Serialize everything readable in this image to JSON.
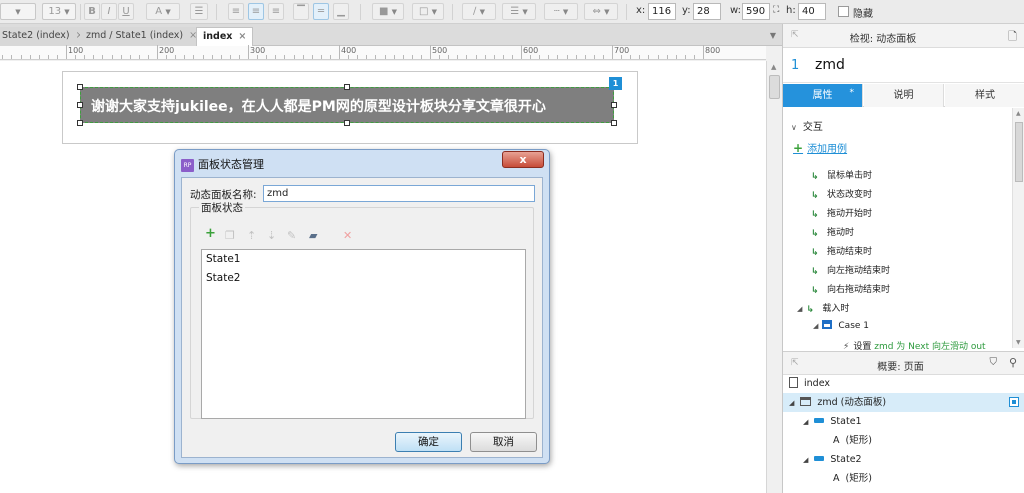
{
  "toolbar": {
    "font_size": "13",
    "x_label": "x:",
    "x_value": "116",
    "y_label": "y:",
    "y_value": "28",
    "w_label": "w:",
    "w_value": "590",
    "h_label": "h:",
    "h_value": "40",
    "hide_label": "隐藏",
    "bold": "B",
    "italic": "I",
    "underline": "U",
    "font_color": "A"
  },
  "tabs": [
    {
      "label": "State2 (index)",
      "close": "×"
    },
    {
      "label": "zmd / State1 (index)",
      "close": "×"
    },
    {
      "label": "index",
      "close": "×"
    }
  ],
  "ruler": {
    "labels": [
      "100",
      "200",
      "300",
      "400",
      "500",
      "600",
      "700",
      "800"
    ]
  },
  "canvas": {
    "panel_text": "谢谢大家支持jukilee，在人人都是PM网的原型设计板块分享文章很开心",
    "badge": "1"
  },
  "dialog": {
    "title": "面板状态管理",
    "icon_text": "RP",
    "close": "x",
    "name_label": "动态面板名称:",
    "name_value": "zmd",
    "group_title": "面板状态",
    "states": [
      "State1",
      "State2"
    ],
    "ok": "确定",
    "cancel": "取消"
  },
  "inspector": {
    "title": "检视: 动态面板",
    "object_number": "1",
    "object_name": "zmd",
    "tabs": [
      "属性",
      "说明",
      "样式"
    ],
    "tab_star": "*",
    "interaction": "交互",
    "add_case": "添加用例",
    "events": [
      "鼠标单击时",
      "状态改变时",
      "拖动开始时",
      "拖动时",
      "拖动结束时",
      "向左拖动结束时",
      "向右拖动结束时"
    ],
    "onload": "载入时",
    "case_name": "Case 1",
    "action_prefix": "设置",
    "action_detail": "zmd 为 Next 向左滑动 out"
  },
  "outline": {
    "title": "概要: 页面",
    "page": "index",
    "panel": "zmd (动态面板)",
    "states": [
      {
        "name": "State1",
        "child": "(矩形)"
      },
      {
        "name": "State2",
        "child": "(矩形)"
      }
    ],
    "child_icon": "A"
  },
  "colors": {
    "accent": "#2592dc",
    "panel_bg": "#7f7f7f",
    "selection_outline": "#3d9e3d"
  }
}
